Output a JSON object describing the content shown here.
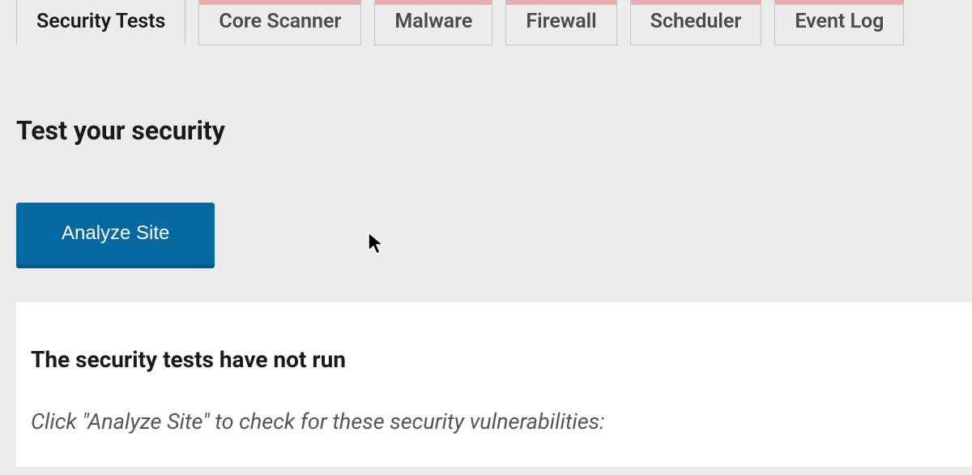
{
  "tabs": [
    {
      "label": "Security Tests",
      "active": true
    },
    {
      "label": "Core Scanner",
      "active": false
    },
    {
      "label": "Malware",
      "active": false
    },
    {
      "label": "Firewall",
      "active": false
    },
    {
      "label": "Scheduler",
      "active": false
    },
    {
      "label": "Event Log",
      "active": false
    }
  ],
  "main": {
    "heading": "Test your security",
    "analyze_button": "Analyze Site"
  },
  "panel": {
    "heading": "The security tests have not run",
    "subtext": "Click \"Analyze Site\" to check for these security vulnerabilities:"
  }
}
